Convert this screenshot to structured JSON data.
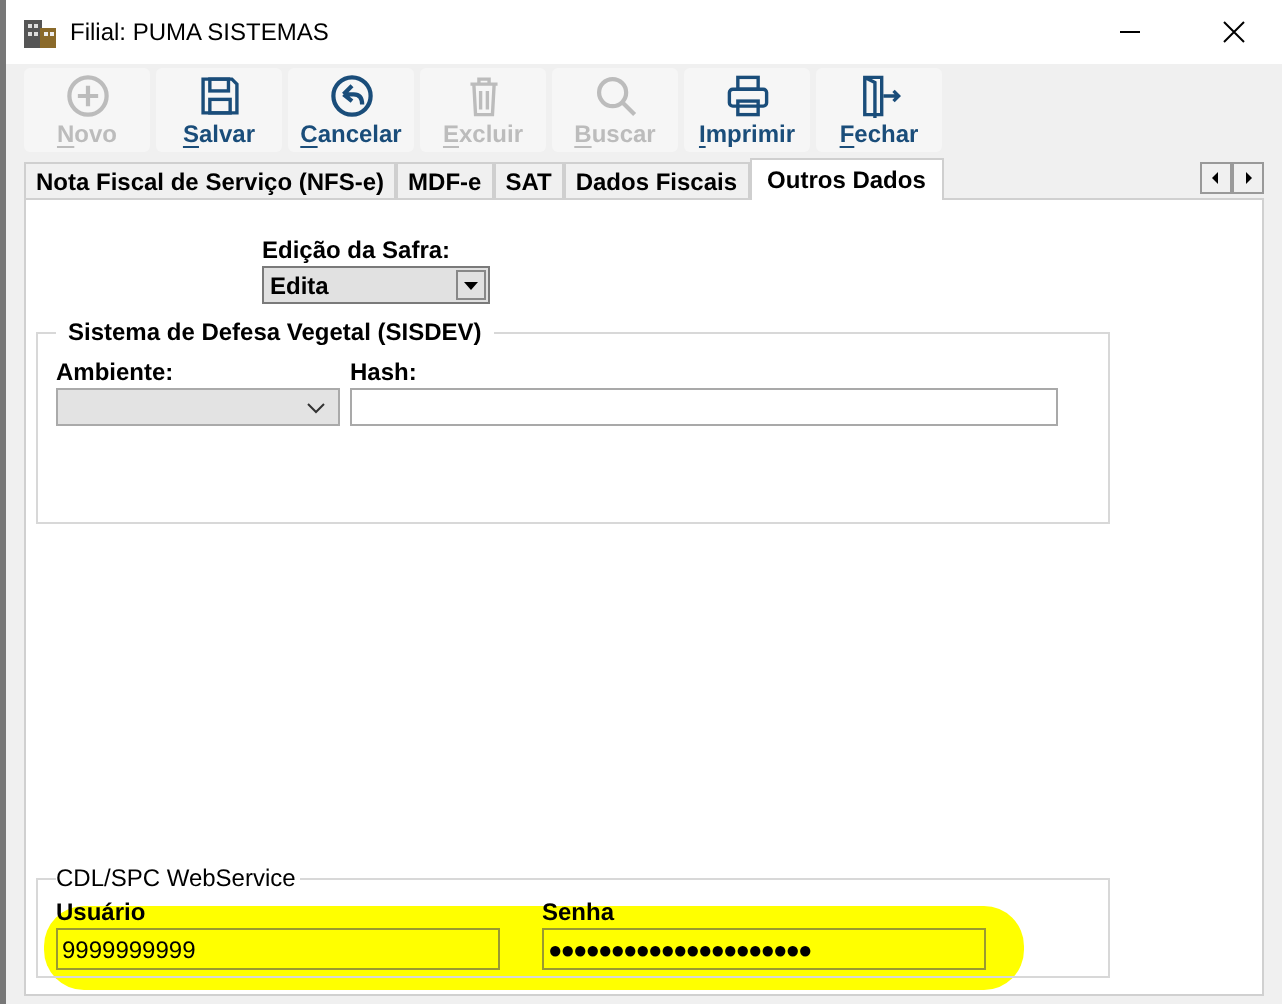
{
  "window": {
    "title": "Filial:  PUMA SISTEMAS"
  },
  "toolbar": [
    {
      "label": "Novo",
      "kind": "plus",
      "disabled": true
    },
    {
      "label": "Salvar",
      "kind": "save",
      "disabled": false
    },
    {
      "label": "Cancelar",
      "kind": "back",
      "disabled": false
    },
    {
      "label": "Excluir",
      "kind": "trash",
      "disabled": true
    },
    {
      "label": "Buscar",
      "kind": "search",
      "disabled": true
    },
    {
      "label": "Imprimir",
      "kind": "print",
      "disabled": false
    },
    {
      "label": "Fechar",
      "kind": "exit",
      "disabled": false
    }
  ],
  "tabs": [
    {
      "label": "Nota Fiscal de Serviço (NFS-e)",
      "selected": false
    },
    {
      "label": "MDF-e",
      "selected": false
    },
    {
      "label": "SAT",
      "selected": false
    },
    {
      "label": "Dados Fiscais",
      "selected": false
    },
    {
      "label": "Outros Dados",
      "selected": true
    }
  ],
  "safra": {
    "label": "Edição da Safra:",
    "value": "Edita"
  },
  "sisdev": {
    "title": "Sistema de Defesa Vegetal (SISDEV)",
    "ambiente_label": "Ambiente:",
    "hash_label": "Hash:"
  },
  "cdl": {
    "title": "CDL/SPC WebService",
    "user_label": "Usuário",
    "user_value": "9999999999",
    "password_label": "Senha",
    "password_value": "●●●●●●●●●●●●●●●●●●●●●"
  }
}
